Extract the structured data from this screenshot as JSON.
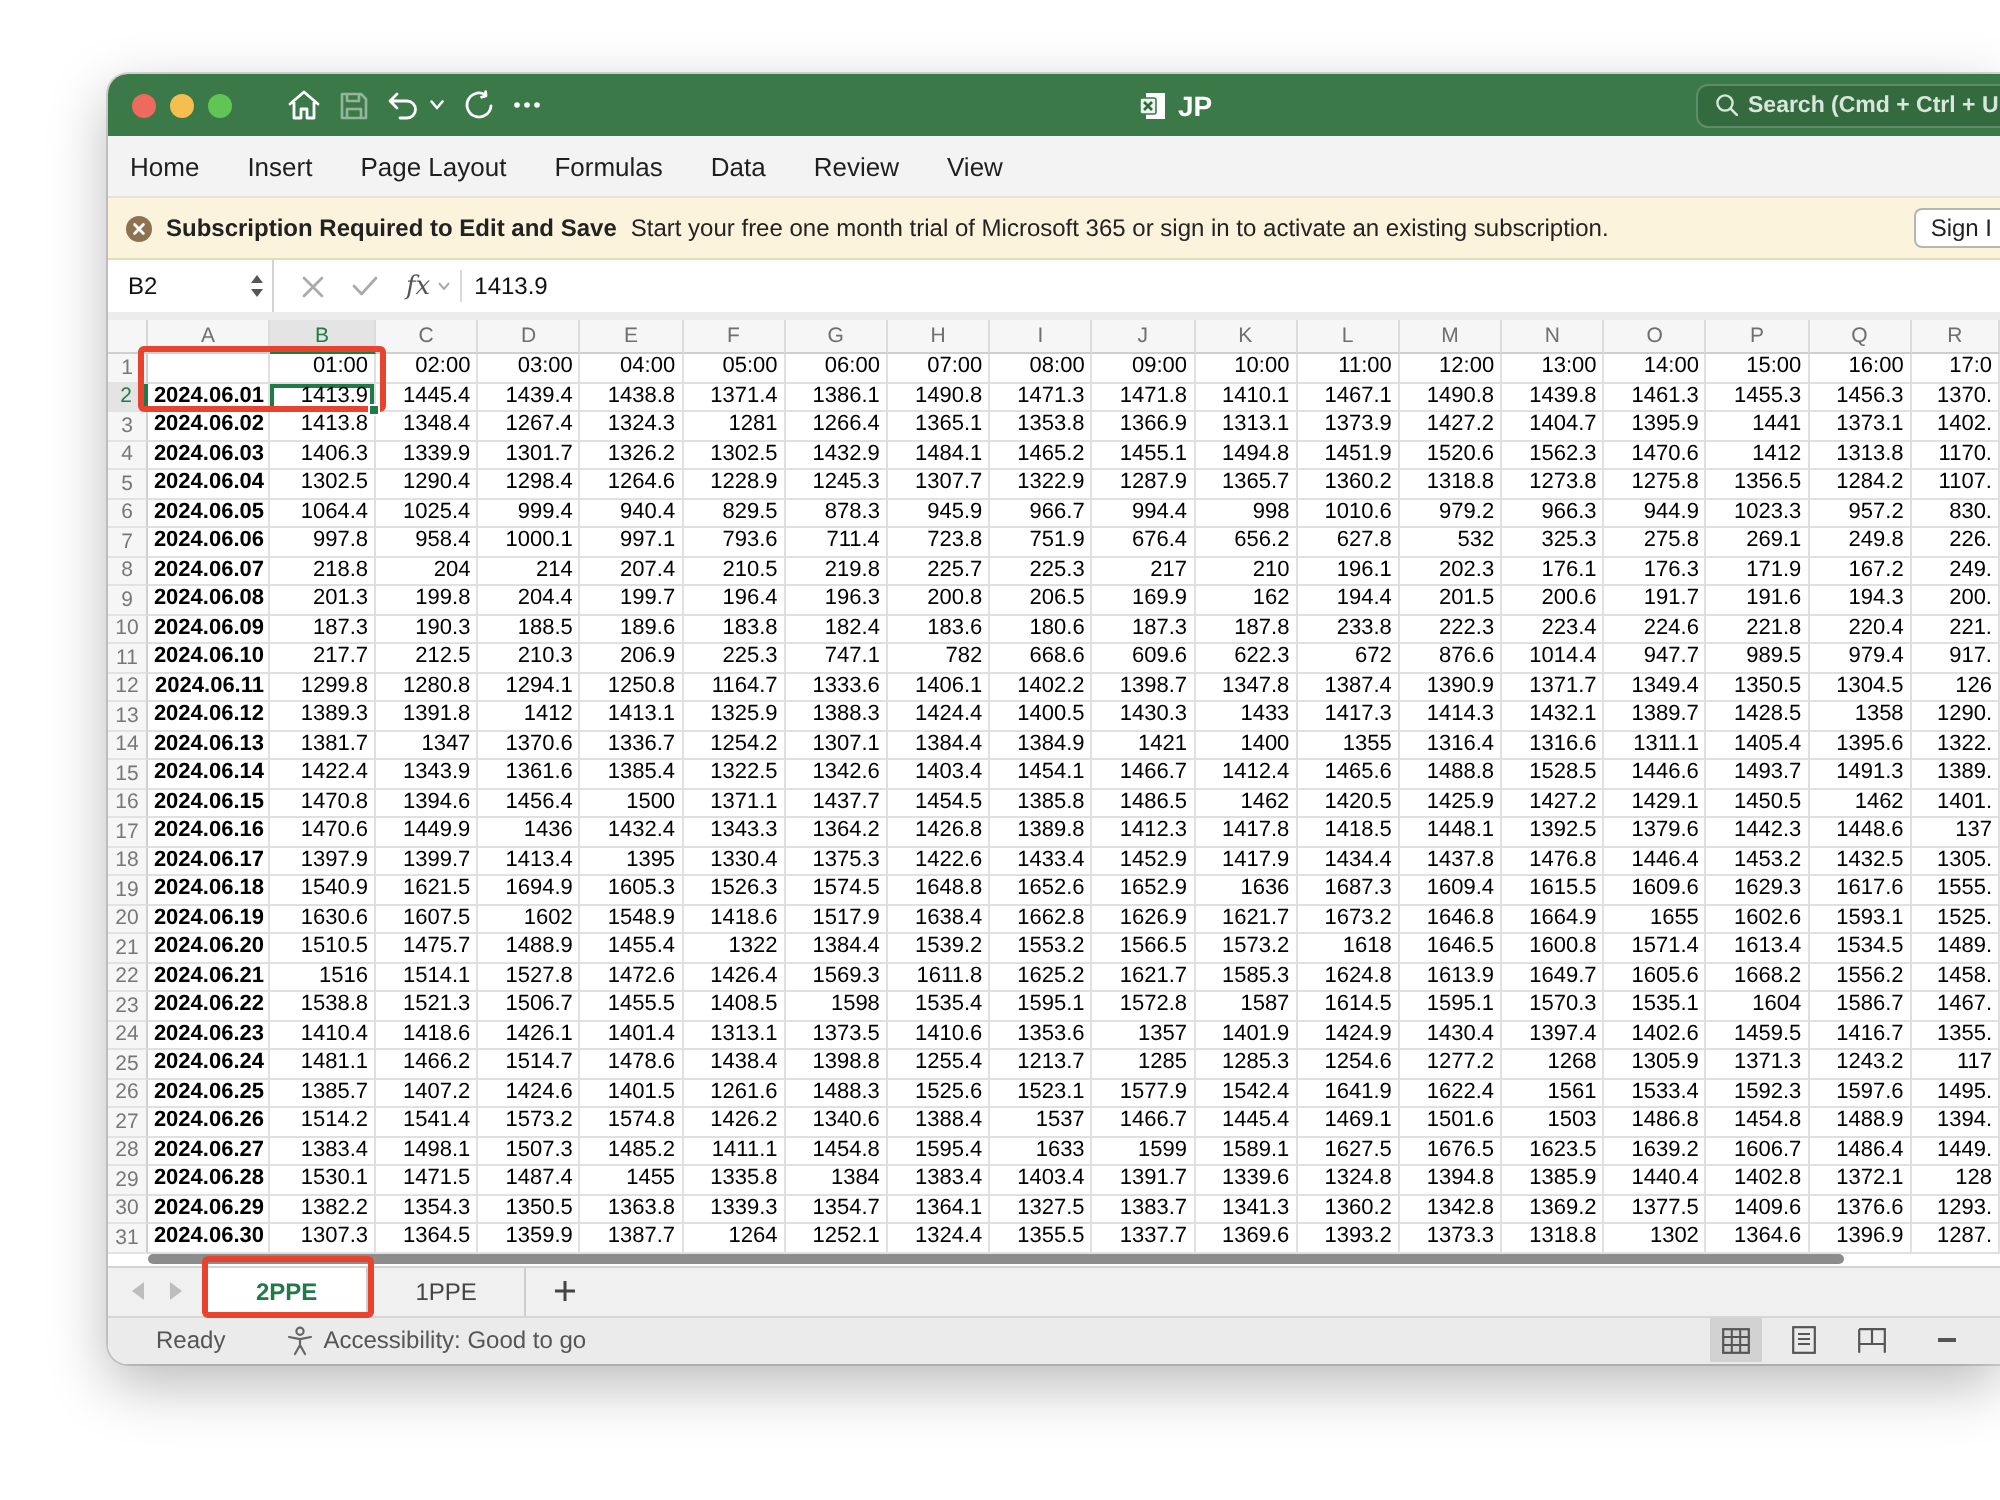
{
  "window": {
    "title": "JP",
    "search_placeholder": "Search (Cmd + Ctrl + U"
  },
  "quick_access": [
    {
      "kind": "home",
      "disabled": false
    },
    {
      "kind": "save",
      "disabled": true
    },
    {
      "kind": "undo",
      "disabled": false
    },
    {
      "kind": "undo_menu",
      "disabled": false
    },
    {
      "kind": "redo",
      "disabled": false
    },
    {
      "kind": "more",
      "disabled": false
    }
  ],
  "menu": [
    "Home",
    "Insert",
    "Page Layout",
    "Formulas",
    "Data",
    "Review",
    "View"
  ],
  "banner": {
    "title": "Subscription Required to Edit and Save",
    "message": "Start your free one month trial of Microsoft 365 or sign in to activate an existing subscription.",
    "button": "Sign I"
  },
  "formula_bar": {
    "name_box": "B2",
    "function_label": "fx",
    "value": "1413.9"
  },
  "columns": [
    {
      "label": "A",
      "selected": false,
      "marked": true
    },
    {
      "label": "B",
      "selected": true,
      "marked": true
    },
    {
      "label": "C",
      "selected": false,
      "marked": false
    },
    {
      "label": "D",
      "selected": false,
      "marked": false
    },
    {
      "label": "E",
      "selected": false,
      "marked": false
    },
    {
      "label": "F",
      "selected": false,
      "marked": false
    },
    {
      "label": "G",
      "selected": false,
      "marked": false
    },
    {
      "label": "H",
      "selected": false,
      "marked": false
    },
    {
      "label": "I",
      "selected": false,
      "marked": false
    },
    {
      "label": "J",
      "selected": false,
      "marked": false
    },
    {
      "label": "K",
      "selected": false,
      "marked": false
    },
    {
      "label": "L",
      "selected": false,
      "marked": false
    },
    {
      "label": "M",
      "selected": false,
      "marked": false
    },
    {
      "label": "N",
      "selected": false,
      "marked": false
    },
    {
      "label": "O",
      "selected": false,
      "marked": false
    },
    {
      "label": "P",
      "selected": false,
      "marked": false
    },
    {
      "label": "Q",
      "selected": false,
      "marked": false
    },
    {
      "label": "R",
      "selected": false,
      "marked": false
    }
  ],
  "rows": [
    {
      "number": "1",
      "selected": false,
      "marked": true,
      "values": [
        "01:00",
        "02:00",
        "03:00",
        "04:00",
        "05:00",
        "06:00",
        "07:00",
        "08:00",
        "09:00",
        "10:00",
        "11:00",
        "12:00",
        "13:00",
        "14:00",
        "15:00",
        "16:00",
        "17:0"
      ]
    },
    {
      "number": "2",
      "selected": true,
      "marked": true,
      "date": "2024.06.01",
      "values": [
        "1413.9",
        "1445.4",
        "1439.4",
        "1438.8",
        "1371.4",
        "1386.1",
        "1490.8",
        "1471.3",
        "1471.8",
        "1410.1",
        "1467.1",
        "1490.8",
        "1439.8",
        "1461.3",
        "1455.3",
        "1456.3",
        "1370."
      ]
    },
    {
      "number": "3",
      "selected": false,
      "marked": false,
      "date": "2024.06.02",
      "values": [
        "1413.8",
        "1348.4",
        "1267.4",
        "1324.3",
        "1281",
        "1266.4",
        "1365.1",
        "1353.8",
        "1366.9",
        "1313.1",
        "1373.9",
        "1427.2",
        "1404.7",
        "1395.9",
        "1441",
        "1373.1",
        "1402."
      ]
    },
    {
      "number": "4",
      "selected": false,
      "marked": false,
      "date": "2024.06.03",
      "values": [
        "1406.3",
        "1339.9",
        "1301.7",
        "1326.2",
        "1302.5",
        "1432.9",
        "1484.1",
        "1465.2",
        "1455.1",
        "1494.8",
        "1451.9",
        "1520.6",
        "1562.3",
        "1470.6",
        "1412",
        "1313.8",
        "1170."
      ]
    },
    {
      "number": "5",
      "selected": false,
      "marked": false,
      "date": "2024.06.04",
      "values": [
        "1302.5",
        "1290.4",
        "1298.4",
        "1264.6",
        "1228.9",
        "1245.3",
        "1307.7",
        "1322.9",
        "1287.9",
        "1365.7",
        "1360.2",
        "1318.8",
        "1273.8",
        "1275.8",
        "1356.5",
        "1284.2",
        "1107."
      ]
    },
    {
      "number": "6",
      "selected": false,
      "marked": false,
      "date": "2024.06.05",
      "values": [
        "1064.4",
        "1025.4",
        "999.4",
        "940.4",
        "829.5",
        "878.3",
        "945.9",
        "966.7",
        "994.4",
        "998",
        "1010.6",
        "979.2",
        "966.3",
        "944.9",
        "1023.3",
        "957.2",
        "830."
      ]
    },
    {
      "number": "7",
      "selected": false,
      "marked": false,
      "date": "2024.06.06",
      "values": [
        "997.8",
        "958.4",
        "1000.1",
        "997.1",
        "793.6",
        "711.4",
        "723.8",
        "751.9",
        "676.4",
        "656.2",
        "627.8",
        "532",
        "325.3",
        "275.8",
        "269.1",
        "249.8",
        "226."
      ]
    },
    {
      "number": "8",
      "selected": false,
      "marked": false,
      "date": "2024.06.07",
      "values": [
        "218.8",
        "204",
        "214",
        "207.4",
        "210.5",
        "219.8",
        "225.7",
        "225.3",
        "217",
        "210",
        "196.1",
        "202.3",
        "176.1",
        "176.3",
        "171.9",
        "167.2",
        "249."
      ]
    },
    {
      "number": "9",
      "selected": false,
      "marked": false,
      "date": "2024.06.08",
      "values": [
        "201.3",
        "199.8",
        "204.4",
        "199.7",
        "196.4",
        "196.3",
        "200.8",
        "206.5",
        "169.9",
        "162",
        "194.4",
        "201.5",
        "200.6",
        "191.7",
        "191.6",
        "194.3",
        "200."
      ]
    },
    {
      "number": "10",
      "selected": false,
      "marked": false,
      "date": "2024.06.09",
      "values": [
        "187.3",
        "190.3",
        "188.5",
        "189.6",
        "183.8",
        "182.4",
        "183.6",
        "180.6",
        "187.3",
        "187.8",
        "233.8",
        "222.3",
        "223.4",
        "224.6",
        "221.8",
        "220.4",
        "221."
      ]
    },
    {
      "number": "11",
      "selected": false,
      "marked": false,
      "date": "2024.06.10",
      "values": [
        "217.7",
        "212.5",
        "210.3",
        "206.9",
        "225.3",
        "747.1",
        "782",
        "668.6",
        "609.6",
        "622.3",
        "672",
        "876.6",
        "1014.4",
        "947.7",
        "989.5",
        "979.4",
        "917."
      ]
    },
    {
      "number": "12",
      "selected": false,
      "marked": false,
      "date": "2024.06.11",
      "values": [
        "1299.8",
        "1280.8",
        "1294.1",
        "1250.8",
        "1164.7",
        "1333.6",
        "1406.1",
        "1402.2",
        "1398.7",
        "1347.8",
        "1387.4",
        "1390.9",
        "1371.7",
        "1349.4",
        "1350.5",
        "1304.5",
        "126"
      ]
    },
    {
      "number": "13",
      "selected": false,
      "marked": false,
      "date": "2024.06.12",
      "values": [
        "1389.3",
        "1391.8",
        "1412",
        "1413.1",
        "1325.9",
        "1388.3",
        "1424.4",
        "1400.5",
        "1430.3",
        "1433",
        "1417.3",
        "1414.3",
        "1432.1",
        "1389.7",
        "1428.5",
        "1358",
        "1290."
      ]
    },
    {
      "number": "14",
      "selected": false,
      "marked": false,
      "date": "2024.06.13",
      "values": [
        "1381.7",
        "1347",
        "1370.6",
        "1336.7",
        "1254.2",
        "1307.1",
        "1384.4",
        "1384.9",
        "1421",
        "1400",
        "1355",
        "1316.4",
        "1316.6",
        "1311.1",
        "1405.4",
        "1395.6",
        "1322."
      ]
    },
    {
      "number": "15",
      "selected": false,
      "marked": false,
      "date": "2024.06.14",
      "values": [
        "1422.4",
        "1343.9",
        "1361.6",
        "1385.4",
        "1322.5",
        "1342.6",
        "1403.4",
        "1454.1",
        "1466.7",
        "1412.4",
        "1465.6",
        "1488.8",
        "1528.5",
        "1446.6",
        "1493.7",
        "1491.3",
        "1389."
      ]
    },
    {
      "number": "16",
      "selected": false,
      "marked": false,
      "date": "2024.06.15",
      "values": [
        "1470.8",
        "1394.6",
        "1456.4",
        "1500",
        "1371.1",
        "1437.7",
        "1454.5",
        "1385.8",
        "1486.5",
        "1462",
        "1420.5",
        "1425.9",
        "1427.2",
        "1429.1",
        "1450.5",
        "1462",
        "1401."
      ]
    },
    {
      "number": "17",
      "selected": false,
      "marked": false,
      "date": "2024.06.16",
      "values": [
        "1470.6",
        "1449.9",
        "1436",
        "1432.4",
        "1343.3",
        "1364.2",
        "1426.8",
        "1389.8",
        "1412.3",
        "1417.8",
        "1418.5",
        "1448.1",
        "1392.5",
        "1379.6",
        "1442.3",
        "1448.6",
        "137"
      ]
    },
    {
      "number": "18",
      "selected": false,
      "marked": false,
      "date": "2024.06.17",
      "values": [
        "1397.9",
        "1399.7",
        "1413.4",
        "1395",
        "1330.4",
        "1375.3",
        "1422.6",
        "1433.4",
        "1452.9",
        "1417.9",
        "1434.4",
        "1437.8",
        "1476.8",
        "1446.4",
        "1453.2",
        "1432.5",
        "1305."
      ]
    },
    {
      "number": "19",
      "selected": false,
      "marked": false,
      "date": "2024.06.18",
      "values": [
        "1540.9",
        "1621.5",
        "1694.9",
        "1605.3",
        "1526.3",
        "1574.5",
        "1648.8",
        "1652.6",
        "1652.9",
        "1636",
        "1687.3",
        "1609.4",
        "1615.5",
        "1609.6",
        "1629.3",
        "1617.6",
        "1555."
      ]
    },
    {
      "number": "20",
      "selected": false,
      "marked": false,
      "date": "2024.06.19",
      "values": [
        "1630.6",
        "1607.5",
        "1602",
        "1548.9",
        "1418.6",
        "1517.9",
        "1638.4",
        "1662.8",
        "1626.9",
        "1621.7",
        "1673.2",
        "1646.8",
        "1664.9",
        "1655",
        "1602.6",
        "1593.1",
        "1525."
      ]
    },
    {
      "number": "21",
      "selected": false,
      "marked": false,
      "date": "2024.06.20",
      "values": [
        "1510.5",
        "1475.7",
        "1488.9",
        "1455.4",
        "1322",
        "1384.4",
        "1539.2",
        "1553.2",
        "1566.5",
        "1573.2",
        "1618",
        "1646.5",
        "1600.8",
        "1571.4",
        "1613.4",
        "1534.5",
        "1489."
      ]
    },
    {
      "number": "22",
      "selected": false,
      "marked": false,
      "date": "2024.06.21",
      "values": [
        "1516",
        "1514.1",
        "1527.8",
        "1472.6",
        "1426.4",
        "1569.3",
        "1611.8",
        "1625.2",
        "1621.7",
        "1585.3",
        "1624.8",
        "1613.9",
        "1649.7",
        "1605.6",
        "1668.2",
        "1556.2",
        "1458."
      ]
    },
    {
      "number": "23",
      "selected": false,
      "marked": false,
      "date": "2024.06.22",
      "values": [
        "1538.8",
        "1521.3",
        "1506.7",
        "1455.5",
        "1408.5",
        "1598",
        "1535.4",
        "1595.1",
        "1572.8",
        "1587",
        "1614.5",
        "1595.1",
        "1570.3",
        "1535.1",
        "1604",
        "1586.7",
        "1467."
      ]
    },
    {
      "number": "24",
      "selected": false,
      "marked": false,
      "date": "2024.06.23",
      "values": [
        "1410.4",
        "1418.6",
        "1426.1",
        "1401.4",
        "1313.1",
        "1373.5",
        "1410.6",
        "1353.6",
        "1357",
        "1401.9",
        "1424.9",
        "1430.4",
        "1397.4",
        "1402.6",
        "1459.5",
        "1416.7",
        "1355."
      ]
    },
    {
      "number": "25",
      "selected": false,
      "marked": false,
      "date": "2024.06.24",
      "values": [
        "1481.1",
        "1466.2",
        "1514.7",
        "1478.6",
        "1438.4",
        "1398.8",
        "1255.4",
        "1213.7",
        "1285",
        "1285.3",
        "1254.6",
        "1277.2",
        "1268",
        "1305.9",
        "1371.3",
        "1243.2",
        "117"
      ]
    },
    {
      "number": "26",
      "selected": false,
      "marked": false,
      "date": "2024.06.25",
      "values": [
        "1385.7",
        "1407.2",
        "1424.6",
        "1401.5",
        "1261.6",
        "1488.3",
        "1525.6",
        "1523.1",
        "1577.9",
        "1542.4",
        "1641.9",
        "1622.4",
        "1561",
        "1533.4",
        "1592.3",
        "1597.6",
        "1495."
      ]
    },
    {
      "number": "27",
      "selected": false,
      "marked": false,
      "date": "2024.06.26",
      "values": [
        "1514.2",
        "1541.4",
        "1573.2",
        "1574.8",
        "1426.2",
        "1340.6",
        "1388.4",
        "1537",
        "1466.7",
        "1445.4",
        "1469.1",
        "1501.6",
        "1503",
        "1486.8",
        "1454.8",
        "1488.9",
        "1394."
      ]
    },
    {
      "number": "28",
      "selected": false,
      "marked": false,
      "date": "2024.06.27",
      "values": [
        "1383.4",
        "1498.1",
        "1507.3",
        "1485.2",
        "1411.1",
        "1454.8",
        "1595.4",
        "1633",
        "1599",
        "1589.1",
        "1627.5",
        "1676.5",
        "1623.5",
        "1639.2",
        "1606.7",
        "1486.4",
        "1449."
      ]
    },
    {
      "number": "29",
      "selected": false,
      "marked": false,
      "date": "2024.06.28",
      "values": [
        "1530.1",
        "1471.5",
        "1487.4",
        "1455",
        "1335.8",
        "1384",
        "1383.4",
        "1403.4",
        "1391.7",
        "1339.6",
        "1324.8",
        "1394.8",
        "1385.9",
        "1440.4",
        "1402.8",
        "1372.1",
        "128"
      ]
    },
    {
      "number": "30",
      "selected": false,
      "marked": false,
      "date": "2024.06.29",
      "values": [
        "1382.2",
        "1354.3",
        "1350.5",
        "1363.8",
        "1339.3",
        "1354.7",
        "1364.1",
        "1327.5",
        "1383.7",
        "1341.3",
        "1360.2",
        "1342.8",
        "1369.2",
        "1377.5",
        "1409.6",
        "1376.6",
        "1293."
      ]
    },
    {
      "number": "31",
      "selected": false,
      "marked": false,
      "date": "2024.06.30",
      "values": [
        "1307.3",
        "1364.5",
        "1359.9",
        "1387.7",
        "1264",
        "1252.1",
        "1324.4",
        "1355.5",
        "1337.7",
        "1369.6",
        "1393.2",
        "1373.3",
        "1318.8",
        "1302",
        "1364.6",
        "1396.9",
        "1287."
      ]
    }
  ],
  "sheet_tabs": [
    {
      "label": "2PPE",
      "selected": true,
      "marked": true
    },
    {
      "label": "1PPE",
      "selected": false,
      "marked": false
    }
  ],
  "status_bar": {
    "status": "Ready",
    "accessibility": "Accessibility: Good to go",
    "views": [
      {
        "kind": "normal",
        "selected": true
      },
      {
        "kind": "page_layout",
        "selected": false
      },
      {
        "kind": "page_break",
        "selected": false
      }
    ]
  }
}
